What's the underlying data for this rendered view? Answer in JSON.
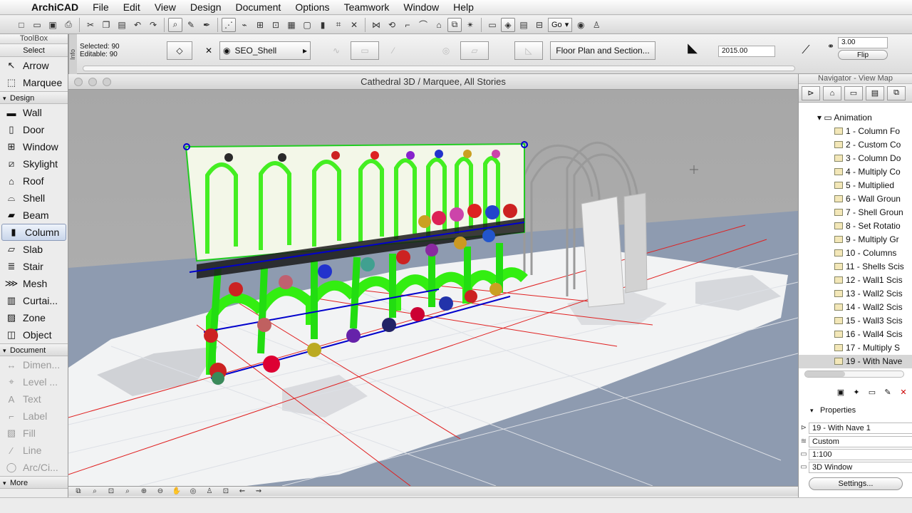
{
  "menubar": {
    "app": "ArchiCAD",
    "items": [
      "File",
      "Edit",
      "View",
      "Design",
      "Document",
      "Options",
      "Teamwork",
      "Window",
      "Help"
    ]
  },
  "toolbar": {
    "go_label": "Go"
  },
  "infobox": {
    "tab_label": "Info",
    "selected": "Selected: 90",
    "editable": "Editable: 90",
    "layer": "SEO_Shell",
    "floorplan": "Floor Plan and Section...",
    "elevation": "2015.00",
    "thickness": "3.00",
    "flip": "Flip"
  },
  "toolbox": {
    "title": "ToolBox",
    "select_head": "Select",
    "select_tools": [
      {
        "icon": "arrow-icon",
        "label": "Arrow"
      },
      {
        "icon": "marquee-icon",
        "label": "Marquee"
      }
    ],
    "design_head": "Design",
    "design_tools": [
      {
        "icon": "wall-icon",
        "label": "Wall"
      },
      {
        "icon": "door-icon",
        "label": "Door"
      },
      {
        "icon": "window-icon",
        "label": "Window"
      },
      {
        "icon": "skylight-icon",
        "label": "Skylight"
      },
      {
        "icon": "roof-icon",
        "label": "Roof"
      },
      {
        "icon": "shell-icon",
        "label": "Shell"
      },
      {
        "icon": "beam-icon",
        "label": "Beam"
      },
      {
        "icon": "column-icon",
        "label": "Column"
      },
      {
        "icon": "slab-icon",
        "label": "Slab"
      },
      {
        "icon": "stair-icon",
        "label": "Stair"
      },
      {
        "icon": "mesh-icon",
        "label": "Mesh"
      },
      {
        "icon": "curtain-wall-icon",
        "label": "Curtai..."
      },
      {
        "icon": "zone-icon",
        "label": "Zone"
      },
      {
        "icon": "object-icon",
        "label": "Object"
      }
    ],
    "document_head": "Document",
    "document_tools": [
      {
        "icon": "dimension-icon",
        "label": "Dimen..."
      },
      {
        "icon": "level-icon",
        "label": "Level ..."
      },
      {
        "icon": "text-icon",
        "label": "Text"
      },
      {
        "icon": "label-icon",
        "label": "Label"
      },
      {
        "icon": "fill-icon",
        "label": "Fill"
      },
      {
        "icon": "line-icon",
        "label": "Line"
      },
      {
        "icon": "arc-icon",
        "label": "Arc/Ci..."
      }
    ],
    "more": "More"
  },
  "viewport": {
    "title": "Cathedral 3D / Marquee, All Stories"
  },
  "navigator": {
    "title": "Navigator - View Map",
    "root": "Animation",
    "items": [
      "1 - Column Fo",
      "2 - Custom Co",
      "3 - Column Do",
      "4 - Multiply Co",
      "5 - Multiplied",
      "6 - Wall Groun",
      "7 - Shell Groun",
      "8 - Set Rotatio",
      "9 - Multiply Gr",
      "10 - Columns",
      "11 - Shells Scis",
      "12 - Wall1 Scis",
      "13 - Wall2 Scis",
      "14 - Wall2 Scis",
      "15 - Wall3 Scis",
      "16 - Wall4 Scis",
      "17 - Multiply S",
      "19 - With Nave"
    ],
    "selected_index": 17,
    "properties_head": "Properties",
    "prop_name": "19 - With Nave 1",
    "prop_custom": "Custom",
    "prop_scale": "1:100",
    "prop_window": "3D Window",
    "settings": "Settings..."
  }
}
